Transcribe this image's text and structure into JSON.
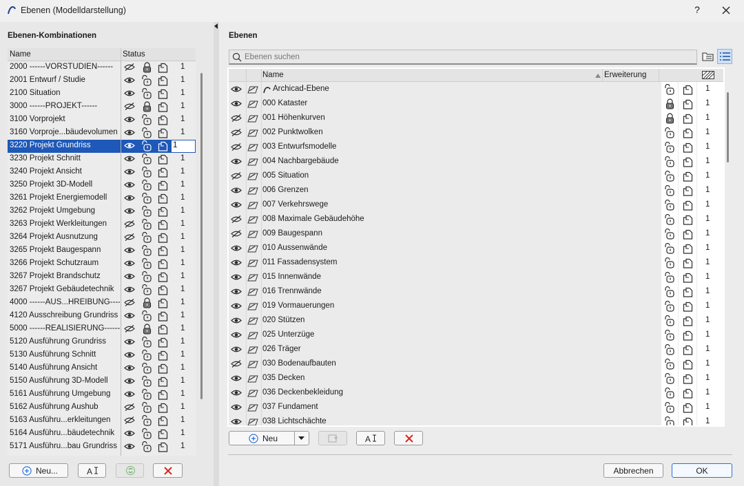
{
  "window": {
    "title": "Ebenen (Modelldarstellung)",
    "help": "?"
  },
  "left": {
    "heading": "Ebenen-Kombinationen",
    "col_name": "Name",
    "col_status": "Status",
    "rows": [
      {
        "name": "2000 ------VORSTUDIEN------",
        "vis": false,
        "locked": true,
        "count": "1"
      },
      {
        "name": "2001 Entwurf / Studie",
        "vis": true,
        "locked": false,
        "count": "1"
      },
      {
        "name": "2100 Situation",
        "vis": true,
        "locked": false,
        "count": "1"
      },
      {
        "name": "3000 ------PROJEKT------",
        "vis": false,
        "locked": true,
        "count": "1"
      },
      {
        "name": "3100 Vorprojekt",
        "vis": true,
        "locked": false,
        "count": "1"
      },
      {
        "name": "3160 Vorproje...bäudevolumen",
        "vis": true,
        "locked": false,
        "count": "1"
      },
      {
        "name": "3220 Projekt Grundriss",
        "vis": true,
        "locked": false,
        "count": "1",
        "selected": true
      },
      {
        "name": "3230 Projekt Schnitt",
        "vis": true,
        "locked": false,
        "count": "1"
      },
      {
        "name": "3240 Projekt Ansicht",
        "vis": true,
        "locked": false,
        "count": "1"
      },
      {
        "name": "3250 Projekt 3D-Modell",
        "vis": true,
        "locked": false,
        "count": "1"
      },
      {
        "name": "3261 Projekt Energiemodell",
        "vis": true,
        "locked": false,
        "count": "1"
      },
      {
        "name": "3262 Projekt Umgebung",
        "vis": true,
        "locked": false,
        "count": "1"
      },
      {
        "name": "3263 Projekt Werkleitungen",
        "vis": false,
        "locked": false,
        "count": "1"
      },
      {
        "name": "3264 Projekt Ausnutzung",
        "vis": false,
        "locked": false,
        "count": "1"
      },
      {
        "name": "3265 Projekt Baugespann",
        "vis": true,
        "locked": false,
        "count": "1"
      },
      {
        "name": "3266 Projekt Schutzraum",
        "vis": true,
        "locked": false,
        "count": "1"
      },
      {
        "name": "3267 Projekt Brandschutz",
        "vis": true,
        "locked": false,
        "count": "1"
      },
      {
        "name": "3267 Projekt Gebäudetechnik",
        "vis": true,
        "locked": false,
        "count": "1"
      },
      {
        "name": "4000 ------AUS...HREIBUNG------",
        "vis": false,
        "locked": true,
        "count": "1"
      },
      {
        "name": "4120 Ausschreibung Grundriss",
        "vis": true,
        "locked": false,
        "count": "1"
      },
      {
        "name": "5000 ------REALISIERUNG------",
        "vis": false,
        "locked": true,
        "count": "1"
      },
      {
        "name": "5120 Ausführung Grundriss",
        "vis": true,
        "locked": false,
        "count": "1"
      },
      {
        "name": "5130 Ausführung Schnitt",
        "vis": true,
        "locked": false,
        "count": "1"
      },
      {
        "name": "5140 Ausführung Ansicht",
        "vis": true,
        "locked": false,
        "count": "1"
      },
      {
        "name": "5150 Ausführung 3D-Modell",
        "vis": true,
        "locked": false,
        "count": "1"
      },
      {
        "name": "5161 Ausführung Umgebung",
        "vis": true,
        "locked": false,
        "count": "1"
      },
      {
        "name": "5162 Ausführung Aushub",
        "vis": false,
        "locked": false,
        "count": "1"
      },
      {
        "name": "5163 Ausführu...erkleitungen",
        "vis": false,
        "locked": false,
        "count": "1"
      },
      {
        "name": "5164 Ausführu...bäudetechnik",
        "vis": true,
        "locked": false,
        "count": "1"
      },
      {
        "name": "5171 Ausführu...bau Grundriss",
        "vis": true,
        "locked": false,
        "count": "1"
      }
    ],
    "btn_new": "Neu..."
  },
  "right": {
    "heading": "Ebenen",
    "search_placeholder": "Ebenen suchen",
    "col_name": "Name",
    "col_ext": "Erweiterung",
    "rows": [
      {
        "name": "Archicad-Ebene",
        "vis": true,
        "locked": false,
        "count": "1",
        "special": true
      },
      {
        "name": "000 Kataster",
        "vis": true,
        "locked": true,
        "count": "1"
      },
      {
        "name": "001 Höhenkurven",
        "vis": false,
        "locked": true,
        "count": "1"
      },
      {
        "name": "002 Punktwolken",
        "vis": false,
        "locked": false,
        "count": "1"
      },
      {
        "name": "003 Entwurfsmodelle",
        "vis": false,
        "locked": false,
        "count": "1"
      },
      {
        "name": "004 Nachbargebäude",
        "vis": true,
        "locked": false,
        "count": "1"
      },
      {
        "name": "005 Situation",
        "vis": false,
        "locked": false,
        "count": "1"
      },
      {
        "name": "006 Grenzen",
        "vis": true,
        "locked": false,
        "count": "1"
      },
      {
        "name": "007 Verkehrswege",
        "vis": true,
        "locked": false,
        "count": "1"
      },
      {
        "name": "008 Maximale Gebäudehöhe",
        "vis": false,
        "locked": false,
        "count": "1"
      },
      {
        "name": "009 Baugespann",
        "vis": false,
        "locked": false,
        "count": "1"
      },
      {
        "name": "010 Aussenwände",
        "vis": true,
        "locked": false,
        "count": "1"
      },
      {
        "name": "011 Fassadensystem",
        "vis": true,
        "locked": false,
        "count": "1"
      },
      {
        "name": "015 Innenwände",
        "vis": true,
        "locked": false,
        "count": "1"
      },
      {
        "name": "016 Trennwände",
        "vis": true,
        "locked": false,
        "count": "1"
      },
      {
        "name": "019 Vormauerungen",
        "vis": true,
        "locked": false,
        "count": "1"
      },
      {
        "name": "020 Stützen",
        "vis": true,
        "locked": false,
        "count": "1"
      },
      {
        "name": "025 Unterzüge",
        "vis": true,
        "locked": false,
        "count": "1"
      },
      {
        "name": "026 Träger",
        "vis": true,
        "locked": false,
        "count": "1"
      },
      {
        "name": "030 Bodenaufbauten",
        "vis": false,
        "locked": false,
        "count": "1"
      },
      {
        "name": "035 Decken",
        "vis": true,
        "locked": false,
        "count": "1"
      },
      {
        "name": "036 Deckenbekleidung",
        "vis": true,
        "locked": false,
        "count": "1"
      },
      {
        "name": "037 Fundament",
        "vis": true,
        "locked": false,
        "count": "1"
      },
      {
        "name": "038 Lichtschächte",
        "vis": true,
        "locked": false,
        "count": "1"
      }
    ],
    "btn_new": "Neu"
  },
  "footer": {
    "cancel": "Abbrechen",
    "ok": "OK"
  },
  "colors": {
    "selection": "#1e58b8",
    "delete_red": "#d9261c",
    "add_blue": "#2b6fd6"
  }
}
